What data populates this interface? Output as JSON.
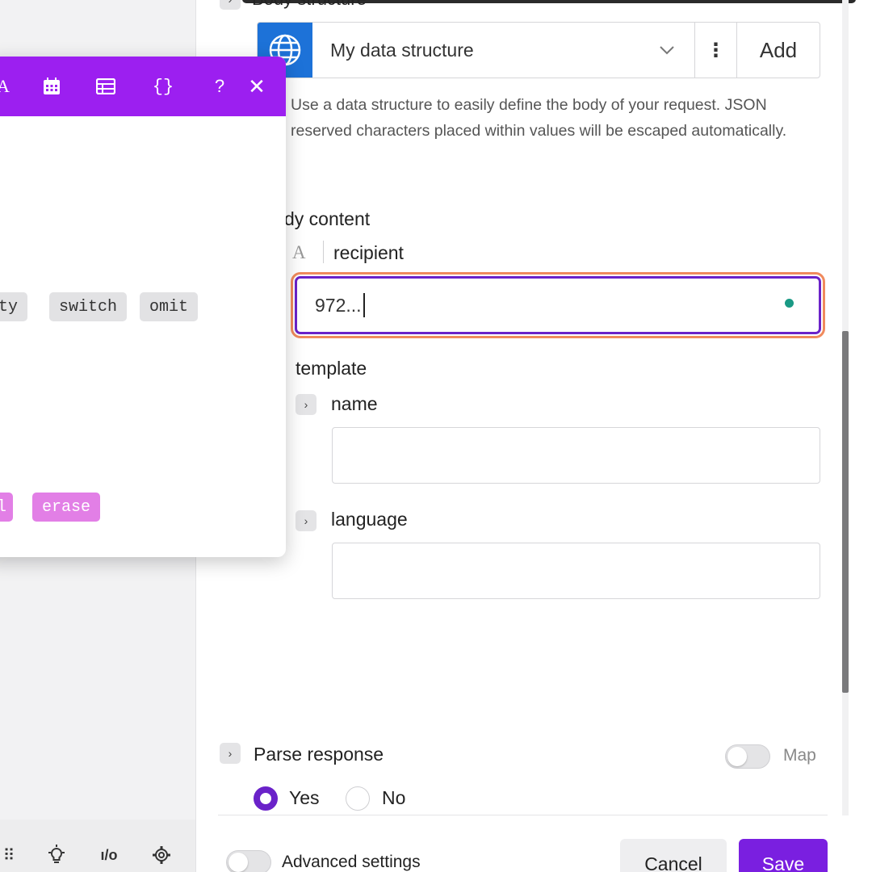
{
  "popup": {
    "chips_gray": [
      "pty",
      "switch",
      "omit"
    ],
    "chips_pink": [
      "ll",
      "erase"
    ],
    "toolbar_icons": [
      "text-icon",
      "calendar-icon",
      "table-icon",
      "braces-icon",
      "help-icon",
      "close-icon"
    ],
    "help_glyph": "?",
    "close_glyph": "✕",
    "text_glyph": "A",
    "braces_glyph": "{}"
  },
  "body_structure": {
    "label": "Body structure",
    "selected": "My data structure",
    "add_label": "Add",
    "help_text": "Use a data structure to easily define the body of your request. JSON reserved characters placed within values will be escaped automatically."
  },
  "body_content": {
    "label": "dy content",
    "recipient_label": "recipient",
    "recipient_value": "972...",
    "template_label": "template",
    "name_label": "name",
    "name_value": "",
    "language_label": "language",
    "language_value": ""
  },
  "parse_response": {
    "label": "Parse response",
    "map_label": "Map",
    "yes_label": "Yes",
    "no_label": "No",
    "selected": "Yes"
  },
  "footer": {
    "advanced_label": "Advanced settings",
    "cancel_label": "Cancel",
    "save_label": "Save"
  },
  "colors": {
    "accent": "#7a1fe0",
    "popup_bar": "#9c1ff0",
    "globe": "#1d72d8",
    "focus_outline": "#f08a5d"
  }
}
